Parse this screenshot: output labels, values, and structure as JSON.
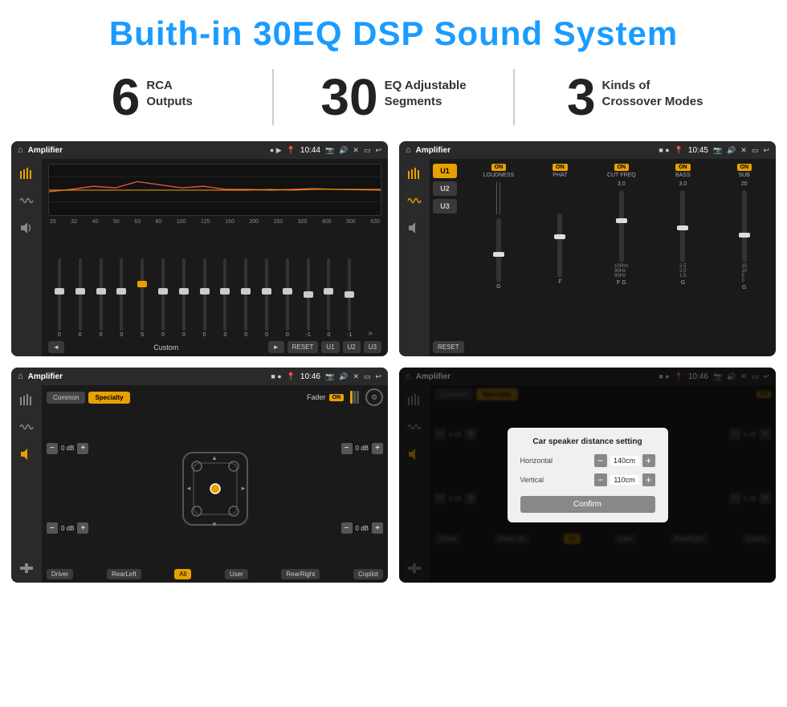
{
  "header": {
    "title": "Buith-in 30EQ DSP Sound System"
  },
  "stats": [
    {
      "number": "6",
      "text": "RCA\nOutputs"
    },
    {
      "number": "30",
      "text": "EQ Adjustable\nSegments"
    },
    {
      "number": "3",
      "text": "Kinds of\nCrossover Modes"
    }
  ],
  "screen1": {
    "topbar": {
      "title": "Amplifier",
      "time": "10:44"
    },
    "eq_labels": [
      "25",
      "32",
      "40",
      "50",
      "63",
      "80",
      "100",
      "125",
      "160",
      "200",
      "250",
      "320",
      "400",
      "500",
      "630"
    ],
    "eq_values": [
      "0",
      "0",
      "0",
      "0",
      "5",
      "0",
      "0",
      "0",
      "0",
      "0",
      "0",
      "0",
      "-1",
      "0",
      "-1"
    ],
    "controls": {
      "prev": "◄",
      "label": "Custom",
      "next": "►",
      "reset": "RESET",
      "u1": "U1",
      "u2": "U2",
      "u3": "U3"
    }
  },
  "screen2": {
    "topbar": {
      "title": "Amplifier",
      "time": "10:45"
    },
    "u_buttons": [
      "U1",
      "U2",
      "U3"
    ],
    "channels": [
      {
        "label": "LOUDNESS",
        "on": true
      },
      {
        "label": "PHAT",
        "on": true
      },
      {
        "label": "CUT FREQ",
        "on": true
      },
      {
        "label": "BASS",
        "on": true
      },
      {
        "label": "SUB",
        "on": true
      }
    ],
    "reset": "RESET"
  },
  "screen3": {
    "topbar": {
      "title": "Amplifier",
      "time": "10:46"
    },
    "tabs": [
      "Common",
      "Specialty"
    ],
    "fader": {
      "label": "Fader",
      "on": true
    },
    "zones": {
      "driver": "Driver",
      "copilot": "Copilot",
      "rear_left": "RearLeft",
      "all": "All",
      "user": "User",
      "rear_right": "RearRight"
    },
    "db_values": [
      "0 dB",
      "0 dB",
      "0 dB",
      "0 dB"
    ]
  },
  "screen4": {
    "topbar": {
      "title": "Amplifier",
      "time": "10:46"
    },
    "tabs": [
      "Common",
      "Specialty"
    ],
    "dialog": {
      "title": "Car speaker distance setting",
      "horizontal_label": "Horizontal",
      "horizontal_value": "140cm",
      "vertical_label": "Vertical",
      "vertical_value": "110cm",
      "confirm": "Confirm"
    },
    "zones": {
      "driver": "Driver",
      "copilot": "Copilot",
      "rear_left": "RearLeft.",
      "all": "All",
      "user": "User",
      "rear_right": "RearRight"
    },
    "db_values": [
      "0 dB",
      "0 dB"
    ]
  }
}
